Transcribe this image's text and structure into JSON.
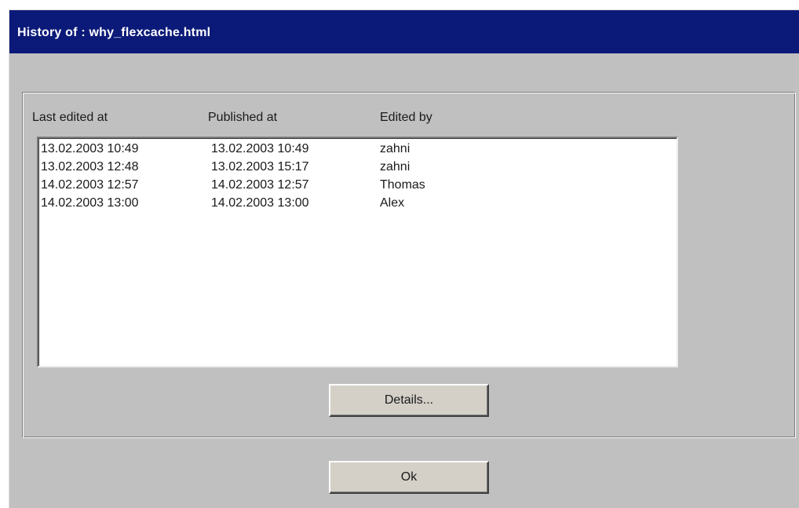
{
  "dialog": {
    "title": "History of : why_flexcache.html"
  },
  "columns": {
    "last_edited": "Last edited at",
    "published": "Published at",
    "edited_by": "Edited by"
  },
  "rows": [
    {
      "last_edited": "13.02.2003 10:49",
      "published": "13.02.2003 10:49",
      "edited_by": "zahni"
    },
    {
      "last_edited": "13.02.2003 12:48",
      "published": "13.02.2003 15:17",
      "edited_by": "zahni"
    },
    {
      "last_edited": "14.02.2003 12:57",
      "published": "14.02.2003 12:57",
      "edited_by": "Thomas"
    },
    {
      "last_edited": "14.02.2003 13:00",
      "published": "14.02.2003 13:00",
      "edited_by": "Alex"
    }
  ],
  "buttons": {
    "details": "Details...",
    "ok": "Ok"
  },
  "colors": {
    "titlebar": "#0b1a78",
    "dialog_background": "#c0c0c0",
    "list_background": "#ffffff"
  }
}
